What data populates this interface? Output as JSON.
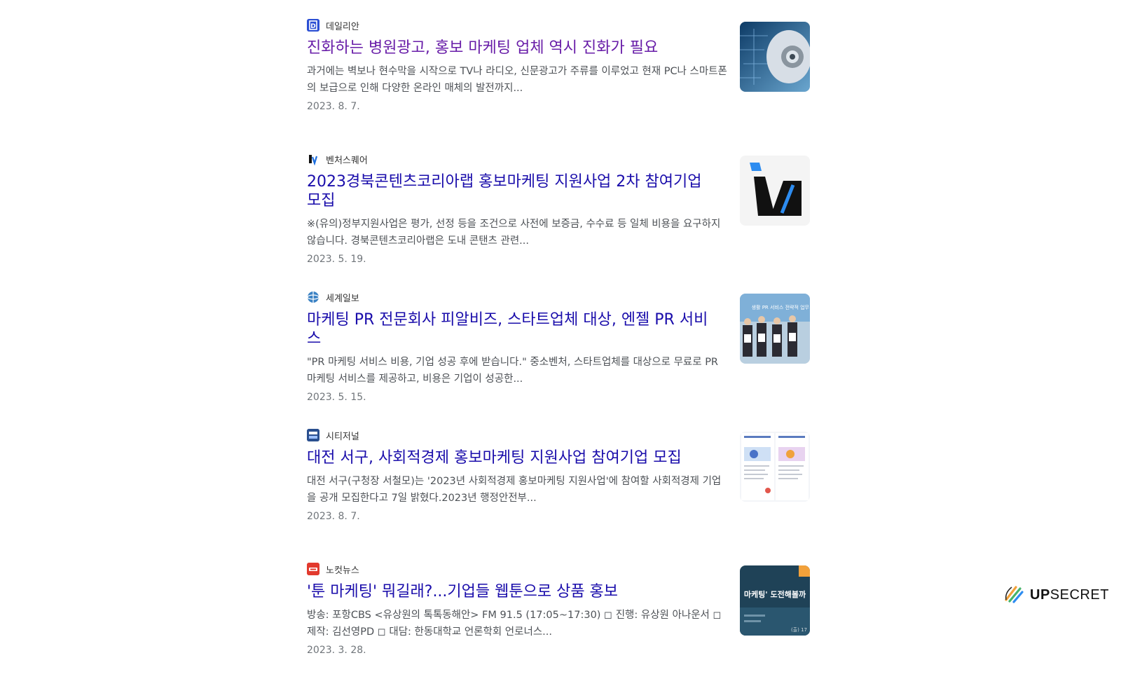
{
  "results": [
    {
      "source": "데일리안",
      "title": "진화하는 병원광고, 홍보 마케팅 업체 역시 진화가 필요",
      "snippet": "과거에는 벽보나 현수막을 시작으로 TV나 라디오, 신문광고가 주류를 이루었고 현재 PC나 스마트폰의 보급으로 인해 다양한 온라인 매체의 발전까지...",
      "date": "2023. 8. 7."
    },
    {
      "source": "벤처스퀘어",
      "title": "2023경북콘텐츠코리아랩 홍보마케팅 지원사업 2차 참여기업 모집",
      "snippet": "※(유의)정부지원사업은 평가, 선정 등을 조건으로 사전에 보증금, 수수료 등 일체 비용을 요구하지 않습니다. 경북콘텐츠코리아랩은 도내 콘탠츠 관련...",
      "date": "2023. 5. 19."
    },
    {
      "source": "세계일보",
      "title": "마케팅 PR 전문회사 피알비즈, 스타트업체 대상, 엔젤 PR 서비스",
      "snippet": "\"PR 마케팅 서비스 비용, 기업 성공 후에 받습니다.\" 중소벤처, 스타트업체를 대상으로 무료로 PR 마케팅 서비스를 제공하고, 비용은 기업이 성공한...",
      "date": "2023. 5. 15."
    },
    {
      "source": "시티저널",
      "title": "대전 서구, 사회적경제 홍보마케팅 지원사업 참여기업 모집",
      "snippet": "대전 서구(구청장 서철모)는 '2023년 사회적경제 홍보마케팅 지원사업'에 참여할 사회적경제 기업을 공개 모집한다고 7일 밝혔다.2023년 행정안전부...",
      "date": "2023. 8. 7."
    },
    {
      "source": "노컷뉴스",
      "title": "'툰 마케팅' 뭐길래?...기업들 웹툰으로 상품 홍보",
      "snippet": "방송: 포항CBS <유상원의 톡톡동해안> FM 91.5 (17:05~17:30) ◻ 진행: 유상원 아나운서 ◻ 제작: 김선영PD ◻ 대담: 한동대학교 언론학회 언로너스...",
      "date": "2023. 3. 28."
    }
  ],
  "thumb_texts": {
    "segye_banner": "생활 PR 서비스 전략적 업무",
    "nocut_banner": "마케팅' 도전해볼까",
    "nocut_small": "(출) 17"
  },
  "brand": {
    "prefix": "UP",
    "suffix": "SECRET"
  },
  "colors": {
    "link": "#1a0dab",
    "visited": "#681da8",
    "snippet": "#4d5156",
    "date": "#70757a"
  }
}
